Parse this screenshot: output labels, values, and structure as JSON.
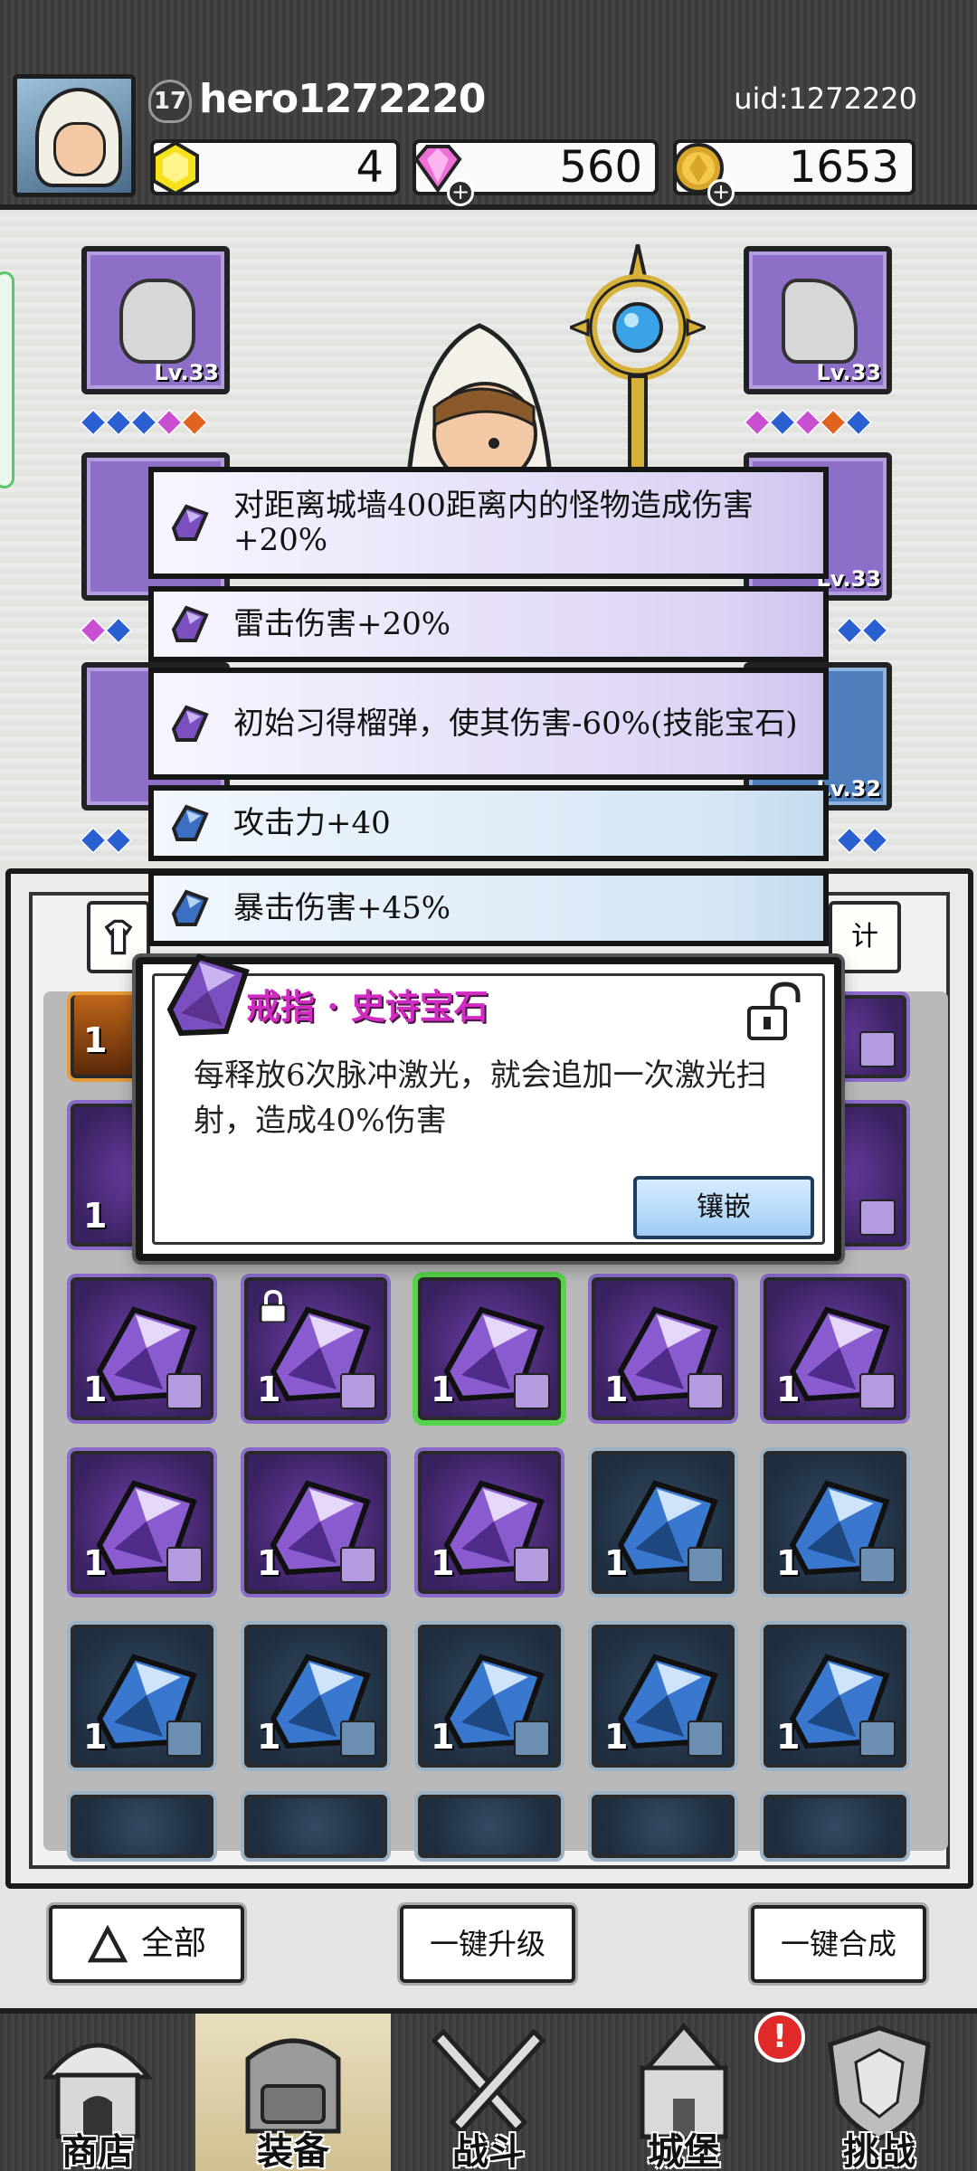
{
  "player": {
    "level": "17",
    "name": "hero1272220",
    "uid": "uid:1272220"
  },
  "resources": [
    {
      "name": "yellow-gem",
      "value": "4",
      "has_plus": false
    },
    {
      "name": "pink-diamond",
      "value": "560",
      "has_plus": true
    },
    {
      "name": "gold-coin",
      "value": "1653",
      "has_plus": true
    }
  ],
  "equipment": {
    "slots": [
      {
        "label": "Lv.33"
      },
      {
        "label": "Lv.33"
      },
      {
        "label": "Lv.33"
      },
      {
        "label": "Lv.32"
      }
    ]
  },
  "bonuses": [
    {
      "text": "对距离城墙400距离内的怪物造成伤害+20%",
      "color": "purple"
    },
    {
      "text": "雷击伤害+20%",
      "color": "purple"
    },
    {
      "text": "初始习得榴弹，使其伤害-60%(技能宝石)",
      "color": "purple"
    },
    {
      "text": "攻击力+40",
      "color": "blue"
    },
    {
      "text": "暴击伤害+45%",
      "color": "blue"
    }
  ],
  "inventory": {
    "tab_right_partial": "计",
    "rows": [
      [
        {
          "color": "purple",
          "qty": "1"
        },
        {
          "color": "purple",
          "qty": "1",
          "locked": true
        },
        {
          "color": "purple",
          "qty": "1",
          "selected": true
        },
        {
          "color": "purple",
          "qty": "1"
        },
        {
          "color": "purple",
          "qty": "1"
        }
      ],
      [
        {
          "color": "purple",
          "qty": "1"
        },
        {
          "color": "purple",
          "qty": "1"
        },
        {
          "color": "purple",
          "qty": "1"
        },
        {
          "color": "blue",
          "qty": "1"
        },
        {
          "color": "blue",
          "qty": "1"
        }
      ],
      [
        {
          "color": "blue",
          "qty": "1"
        },
        {
          "color": "blue",
          "qty": "1"
        },
        {
          "color": "blue",
          "qty": "1"
        },
        {
          "color": "blue",
          "qty": "1"
        },
        {
          "color": "blue",
          "qty": "1"
        }
      ]
    ],
    "partial_qty": "1"
  },
  "popup": {
    "title": "戒指 · 史诗宝石",
    "description": "每释放6次脉冲激光，就会追加一次激光扫射，造成40%伤害",
    "inlay_button": "镶嵌"
  },
  "actions": {
    "filter": "全部",
    "upgrade_all": "一键升级",
    "merge_all": "一键合成"
  },
  "nav": [
    {
      "label": "商店",
      "active": false
    },
    {
      "label": "装备",
      "active": true
    },
    {
      "label": "战斗",
      "active": false
    },
    {
      "label": "城堡",
      "active": false
    },
    {
      "label": "挑战",
      "active": false
    }
  ],
  "notification_badge": "!",
  "colors": {
    "epic_purple": "#7a4fc0",
    "rare_blue": "#3a6fc4",
    "title_pink": "#d22bc3",
    "selected_green": "#56d54a"
  }
}
